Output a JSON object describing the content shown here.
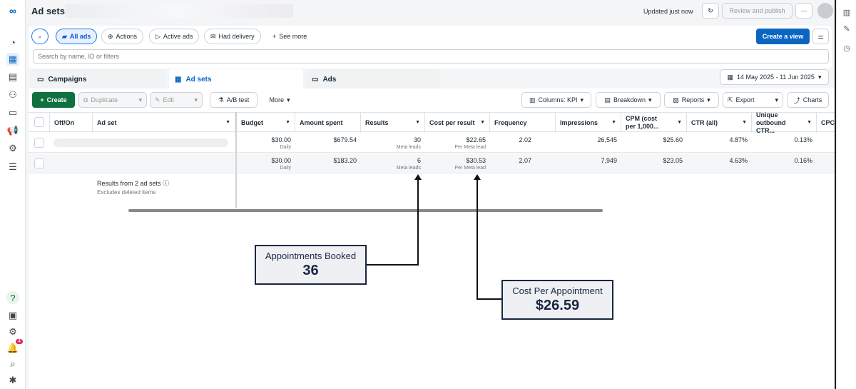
{
  "header": {
    "title": "Ad sets",
    "updated": "Updated just now",
    "review": "Review and publish",
    "more": "⋯"
  },
  "filters": {
    "all_ads": "All ads",
    "actions": "Actions",
    "active_ads": "Active ads",
    "had_delivery": "Had delivery",
    "see_more": "See more",
    "create_view": "Create a view",
    "search_placeholder": "Search by name, ID or filters"
  },
  "tabs": [
    "Campaigns",
    "Ad sets",
    "Ads"
  ],
  "date_range": "14 May 2025 - 11 Jun 2025",
  "toolbar": {
    "create": "Create",
    "duplicate": "Duplicate",
    "edit": "Edit",
    "ab_test": "A/B test",
    "more": "More",
    "columns": "Columns: KPI",
    "breakdown": "Breakdown",
    "reports": "Reports",
    "export": "Export",
    "charts": "Charts"
  },
  "columns": [
    "Off/On",
    "Ad set",
    "Budget",
    "Amount spent",
    "Results",
    "Cost per result",
    "Frequency",
    "Impressions",
    "CPM (cost per 1,000...",
    "CTR (all)",
    "Unique outbound CTR...",
    "CPC"
  ],
  "rows": [
    {
      "budget": "$30.00",
      "budget_sub": "Daily",
      "spent": "$679.54",
      "results": "30",
      "results_sub": "Meta leads",
      "cpr": "$22.65",
      "cpr_sub": "Per Meta lead",
      "frequency": "2.02",
      "impressions": "26,545",
      "cpm": "$25.60",
      "ctr": "4.87%",
      "unique_ctr": "0.13%"
    },
    {
      "budget": "$30.00",
      "budget_sub": "Daily",
      "spent": "$183.20",
      "results": "6",
      "results_sub": "Meta leads",
      "cpr": "$30.53",
      "cpr_sub": "Per Meta lead",
      "frequency": "2.07",
      "impressions": "7,949",
      "cpm": "$23.05",
      "ctr": "4.63%",
      "unique_ctr": "0.16%"
    }
  ],
  "summary": {
    "text": "Results from 2 ad sets",
    "sub": "Excludes deleted items"
  },
  "callouts": {
    "appointments_label": "Appointments Booked",
    "appointments_value": "36",
    "cost_label": "Cost Per Appointment",
    "cost_value": "$26.59"
  },
  "notifications": "4",
  "colors": {
    "accent": "#0a66c2",
    "create": "#0f7040",
    "callout_border": "#1a2741"
  }
}
